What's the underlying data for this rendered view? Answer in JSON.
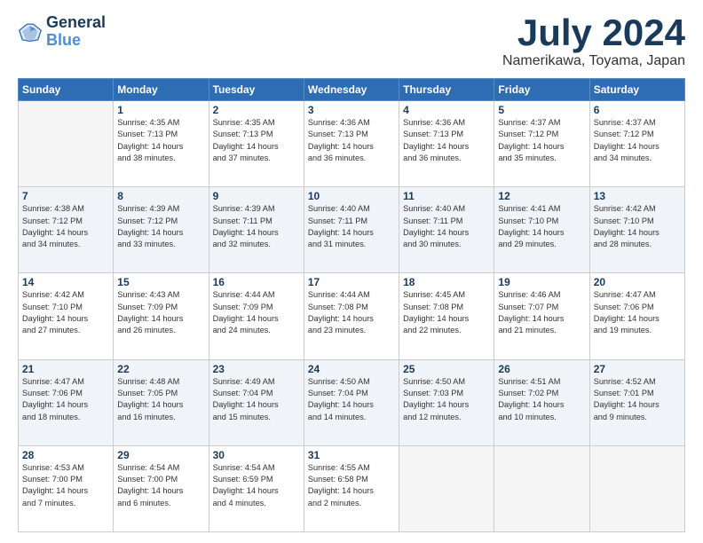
{
  "header": {
    "logo_line1": "General",
    "logo_line2": "Blue",
    "month": "July 2024",
    "location": "Namerikawa, Toyama, Japan"
  },
  "weekdays": [
    "Sunday",
    "Monday",
    "Tuesday",
    "Wednesday",
    "Thursday",
    "Friday",
    "Saturday"
  ],
  "weeks": [
    [
      {
        "day": "",
        "sunrise": "",
        "sunset": "",
        "daylight": ""
      },
      {
        "day": "1",
        "sunrise": "Sunrise: 4:35 AM",
        "sunset": "Sunset: 7:13 PM",
        "daylight": "Daylight: 14 hours and 38 minutes."
      },
      {
        "day": "2",
        "sunrise": "Sunrise: 4:35 AM",
        "sunset": "Sunset: 7:13 PM",
        "daylight": "Daylight: 14 hours and 37 minutes."
      },
      {
        "day": "3",
        "sunrise": "Sunrise: 4:36 AM",
        "sunset": "Sunset: 7:13 PM",
        "daylight": "Daylight: 14 hours and 36 minutes."
      },
      {
        "day": "4",
        "sunrise": "Sunrise: 4:36 AM",
        "sunset": "Sunset: 7:13 PM",
        "daylight": "Daylight: 14 hours and 36 minutes."
      },
      {
        "day": "5",
        "sunrise": "Sunrise: 4:37 AM",
        "sunset": "Sunset: 7:12 PM",
        "daylight": "Daylight: 14 hours and 35 minutes."
      },
      {
        "day": "6",
        "sunrise": "Sunrise: 4:37 AM",
        "sunset": "Sunset: 7:12 PM",
        "daylight": "Daylight: 14 hours and 34 minutes."
      }
    ],
    [
      {
        "day": "7",
        "sunrise": "Sunrise: 4:38 AM",
        "sunset": "Sunset: 7:12 PM",
        "daylight": "Daylight: 14 hours and 34 minutes."
      },
      {
        "day": "8",
        "sunrise": "Sunrise: 4:39 AM",
        "sunset": "Sunset: 7:12 PM",
        "daylight": "Daylight: 14 hours and 33 minutes."
      },
      {
        "day": "9",
        "sunrise": "Sunrise: 4:39 AM",
        "sunset": "Sunset: 7:11 PM",
        "daylight": "Daylight: 14 hours and 32 minutes."
      },
      {
        "day": "10",
        "sunrise": "Sunrise: 4:40 AM",
        "sunset": "Sunset: 7:11 PM",
        "daylight": "Daylight: 14 hours and 31 minutes."
      },
      {
        "day": "11",
        "sunrise": "Sunrise: 4:40 AM",
        "sunset": "Sunset: 7:11 PM",
        "daylight": "Daylight: 14 hours and 30 minutes."
      },
      {
        "day": "12",
        "sunrise": "Sunrise: 4:41 AM",
        "sunset": "Sunset: 7:10 PM",
        "daylight": "Daylight: 14 hours and 29 minutes."
      },
      {
        "day": "13",
        "sunrise": "Sunrise: 4:42 AM",
        "sunset": "Sunset: 7:10 PM",
        "daylight": "Daylight: 14 hours and 28 minutes."
      }
    ],
    [
      {
        "day": "14",
        "sunrise": "Sunrise: 4:42 AM",
        "sunset": "Sunset: 7:10 PM",
        "daylight": "Daylight: 14 hours and 27 minutes."
      },
      {
        "day": "15",
        "sunrise": "Sunrise: 4:43 AM",
        "sunset": "Sunset: 7:09 PM",
        "daylight": "Daylight: 14 hours and 26 minutes."
      },
      {
        "day": "16",
        "sunrise": "Sunrise: 4:44 AM",
        "sunset": "Sunset: 7:09 PM",
        "daylight": "Daylight: 14 hours and 24 minutes."
      },
      {
        "day": "17",
        "sunrise": "Sunrise: 4:44 AM",
        "sunset": "Sunset: 7:08 PM",
        "daylight": "Daylight: 14 hours and 23 minutes."
      },
      {
        "day": "18",
        "sunrise": "Sunrise: 4:45 AM",
        "sunset": "Sunset: 7:08 PM",
        "daylight": "Daylight: 14 hours and 22 minutes."
      },
      {
        "day": "19",
        "sunrise": "Sunrise: 4:46 AM",
        "sunset": "Sunset: 7:07 PM",
        "daylight": "Daylight: 14 hours and 21 minutes."
      },
      {
        "day": "20",
        "sunrise": "Sunrise: 4:47 AM",
        "sunset": "Sunset: 7:06 PM",
        "daylight": "Daylight: 14 hours and 19 minutes."
      }
    ],
    [
      {
        "day": "21",
        "sunrise": "Sunrise: 4:47 AM",
        "sunset": "Sunset: 7:06 PM",
        "daylight": "Daylight: 14 hours and 18 minutes."
      },
      {
        "day": "22",
        "sunrise": "Sunrise: 4:48 AM",
        "sunset": "Sunset: 7:05 PM",
        "daylight": "Daylight: 14 hours and 16 minutes."
      },
      {
        "day": "23",
        "sunrise": "Sunrise: 4:49 AM",
        "sunset": "Sunset: 7:04 PM",
        "daylight": "Daylight: 14 hours and 15 minutes."
      },
      {
        "day": "24",
        "sunrise": "Sunrise: 4:50 AM",
        "sunset": "Sunset: 7:04 PM",
        "daylight": "Daylight: 14 hours and 14 minutes."
      },
      {
        "day": "25",
        "sunrise": "Sunrise: 4:50 AM",
        "sunset": "Sunset: 7:03 PM",
        "daylight": "Daylight: 14 hours and 12 minutes."
      },
      {
        "day": "26",
        "sunrise": "Sunrise: 4:51 AM",
        "sunset": "Sunset: 7:02 PM",
        "daylight": "Daylight: 14 hours and 10 minutes."
      },
      {
        "day": "27",
        "sunrise": "Sunrise: 4:52 AM",
        "sunset": "Sunset: 7:01 PM",
        "daylight": "Daylight: 14 hours and 9 minutes."
      }
    ],
    [
      {
        "day": "28",
        "sunrise": "Sunrise: 4:53 AM",
        "sunset": "Sunset: 7:00 PM",
        "daylight": "Daylight: 14 hours and 7 minutes."
      },
      {
        "day": "29",
        "sunrise": "Sunrise: 4:54 AM",
        "sunset": "Sunset: 7:00 PM",
        "daylight": "Daylight: 14 hours and 6 minutes."
      },
      {
        "day": "30",
        "sunrise": "Sunrise: 4:54 AM",
        "sunset": "Sunset: 6:59 PM",
        "daylight": "Daylight: 14 hours and 4 minutes."
      },
      {
        "day": "31",
        "sunrise": "Sunrise: 4:55 AM",
        "sunset": "Sunset: 6:58 PM",
        "daylight": "Daylight: 14 hours and 2 minutes."
      },
      {
        "day": "",
        "sunrise": "",
        "sunset": "",
        "daylight": ""
      },
      {
        "day": "",
        "sunrise": "",
        "sunset": "",
        "daylight": ""
      },
      {
        "day": "",
        "sunrise": "",
        "sunset": "",
        "daylight": ""
      }
    ]
  ]
}
